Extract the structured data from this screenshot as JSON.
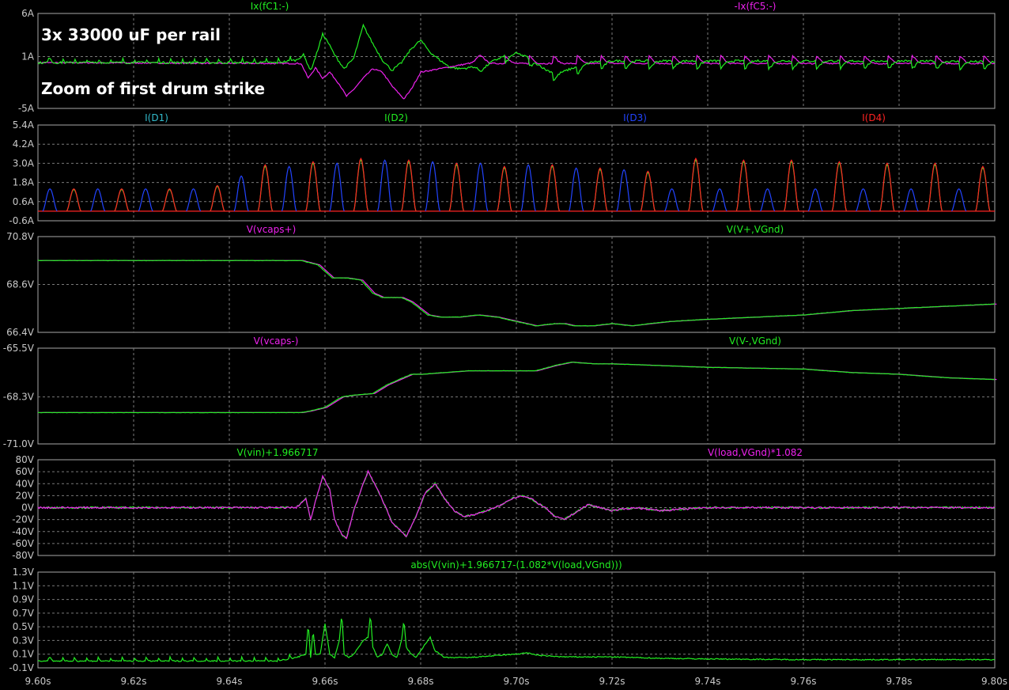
{
  "annotations": {
    "line1": "3x 33000 uF per rail",
    "line2": "Zoom of first drum strike"
  },
  "colors": {
    "background": "#000000",
    "frame": "#a8a8a8",
    "grid": "#7a7a7a",
    "axis_text": "#c8c8c8",
    "green": "#22ee22",
    "magenta": "#ee22ee",
    "blue": "#2244ff",
    "red": "#ff2222",
    "teal": "#33bbcc"
  },
  "chart_data": {
    "type": "line",
    "x_axis": {
      "label": "",
      "range": [
        9.6,
        9.8
      ],
      "ticks": [
        9.6,
        9.62,
        9.64,
        9.66,
        9.68,
        9.7,
        9.72,
        9.74,
        9.76,
        9.78,
        9.8
      ],
      "tick_labels": [
        "9.60s",
        "9.62s",
        "9.64s",
        "9.66s",
        "9.68s",
        "9.70s",
        "9.72s",
        "9.74s",
        "9.76s",
        "9.78s",
        "9.80s"
      ]
    },
    "panes": [
      {
        "id": "cap_currents",
        "ylim": [
          -5,
          6
        ],
        "ticks": [
          -5,
          1,
          6
        ],
        "tick_labels": [
          "-5A",
          "1A",
          "6A"
        ],
        "series": [
          {
            "name": "Ix(fC1:-)",
            "color": "#22ee22",
            "x": [
              9.6,
              9.65,
              9.654,
              9.6555,
              9.657,
              9.658,
              9.6595,
              9.6605,
              9.662,
              9.664,
              9.666,
              9.668,
              9.67,
              9.672,
              9.674,
              9.676,
              9.678,
              9.68,
              9.682,
              9.684,
              9.686,
              9.688,
              9.69,
              9.692,
              9.694,
              9.696,
              9.698,
              9.7,
              9.702,
              9.704,
              9.706,
              9.708,
              9.71,
              9.712,
              9.716,
              9.72,
              9.74,
              9.76,
              9.78,
              9.8
            ],
            "y": [
              0.3,
              0.3,
              0.6,
              1.2,
              -0.6,
              0.9,
              3.6,
              2.8,
              1.2,
              -0.4,
              0.8,
              4.6,
              2.5,
              0.6,
              -0.6,
              0.3,
              1.9,
              2.9,
              1.5,
              0.6,
              -0.2,
              -0.4,
              -0.3,
              0.3,
              0.2,
              0.7,
              1.2,
              1.4,
              1.0,
              0.4,
              -0.5,
              -0.9,
              -0.7,
              -0.3,
              0.4,
              0.5,
              0.5,
              0.5,
              0.5,
              0.4
            ]
          },
          {
            "name": "-Ix(fC5:-)",
            "color": "#ee22ee",
            "x": [
              9.6,
              9.655,
              9.6565,
              9.658,
              9.6595,
              9.661,
              9.663,
              9.6645,
              9.666,
              9.668,
              9.67,
              9.672,
              9.674,
              9.6765,
              9.678,
              9.68,
              9.69,
              9.7,
              9.72,
              9.74,
              9.76,
              9.78,
              9.8
            ],
            "y": [
              0.3,
              0.2,
              -1.5,
              -0.3,
              -1.5,
              -0.8,
              -2.2,
              -3.6,
              -2.8,
              -1.5,
              -0.4,
              -0.8,
              -2.4,
              -3.9,
              -2.8,
              -0.8,
              0.2,
              0.2,
              0.2,
              0.2,
              0.2,
              0.2,
              0.2
            ]
          }
        ]
      },
      {
        "id": "diode_currents",
        "ylim": [
          -0.6,
          5.4
        ],
        "ticks": [
          -0.6,
          0.6,
          1.8,
          3.0,
          4.2,
          5.4
        ],
        "tick_labels": [
          "-0.6A",
          "0.6A",
          "1.8A",
          "3.0A",
          "4.2A",
          "5.4A"
        ],
        "series": [
          {
            "name": "I(D1)",
            "color": "#33bbcc"
          },
          {
            "name": "I(D2)",
            "color": "#22ee22"
          },
          {
            "name": "I(D3)",
            "color": "#2244ff"
          },
          {
            "name": "I(D4)",
            "color": "#ff2222"
          }
        ],
        "pulses": {
          "times": [
            9.6025,
            9.6075,
            9.6125,
            9.6175,
            9.6225,
            9.6275,
            9.6325,
            9.6375,
            9.6425,
            9.6475,
            9.6525,
            9.6575,
            9.6625,
            9.6675,
            9.6725,
            9.6775,
            9.6825,
            9.6875,
            9.6925,
            9.6975,
            9.7025,
            9.7075,
            9.7125,
            9.7175,
            9.7225,
            9.7275,
            9.7325,
            9.7375,
            9.7425,
            9.7475,
            9.7525,
            9.7575,
            9.7625,
            9.7675,
            9.7725,
            9.7775,
            9.7825,
            9.7875,
            9.7925,
            9.7975
          ],
          "peaks": [
            0,
            1.4,
            0,
            1.4,
            0,
            1.4,
            0,
            1.4,
            0,
            1.4,
            0,
            1.4,
            0,
            1.4,
            0,
            1.6,
            0,
            2.2,
            0,
            2.9,
            0,
            2.8,
            0,
            3.1,
            0,
            3.0,
            0,
            3.3,
            0,
            3.2,
            0,
            3.2,
            0,
            3.1,
            0,
            3.0,
            0,
            3.0,
            0,
            2.8,
            0,
            2.9,
            0,
            2.9,
            0,
            2.7,
            0,
            2.7,
            0,
            2.6,
            0,
            2.5
          ],
          "half_width": 0.0015
        }
      },
      {
        "id": "pos_rail",
        "ylim": [
          66.4,
          70.8
        ],
        "ticks": [
          66.4,
          68.6,
          70.8
        ],
        "tick_labels": [
          "66.4V",
          "68.6V",
          "70.8V"
        ],
        "series": [
          {
            "name": "V(vcaps+)",
            "color": "#ee22ee"
          },
          {
            "name": "V(V+,VGnd)",
            "color": "#22ee22",
            "x": [
              9.6,
              9.655,
              9.6585,
              9.6615,
              9.6645,
              9.6675,
              9.67,
              9.672,
              9.676,
              9.678,
              9.6815,
              9.684,
              9.688,
              9.692,
              9.696,
              9.7,
              9.704,
              9.708,
              9.71,
              9.712,
              9.716,
              9.72,
              9.724,
              9.728,
              9.732,
              9.74,
              9.75,
              9.76,
              9.77,
              9.78,
              9.79,
              9.8
            ],
            "y": [
              69.7,
              69.7,
              69.5,
              68.9,
              68.9,
              68.8,
              68.2,
              68.0,
              68.0,
              67.8,
              67.2,
              67.1,
              67.1,
              67.2,
              67.1,
              66.9,
              66.7,
              66.8,
              66.8,
              66.7,
              66.7,
              66.8,
              66.7,
              66.8,
              66.9,
              67.0,
              67.1,
              67.2,
              67.4,
              67.5,
              67.6,
              67.7
            ]
          }
        ]
      },
      {
        "id": "neg_rail",
        "ylim": [
          -71.0,
          -65.5
        ],
        "ticks": [
          -71.0,
          -68.3,
          -65.5
        ],
        "tick_labels": [
          "-71.0V",
          "-68.3V",
          "-65.5V"
        ],
        "series": [
          {
            "name": "V(vcaps-)",
            "color": "#ee22ee"
          },
          {
            "name": "V(V-,VGnd)",
            "color": "#22ee22",
            "x": [
              9.6,
              9.655,
              9.657,
              9.66,
              9.6635,
              9.666,
              9.67,
              9.673,
              9.678,
              9.68,
              9.69,
              9.7,
              9.704,
              9.708,
              9.7115,
              9.716,
              9.72,
              9.74,
              9.76,
              9.77,
              9.78,
              9.79,
              9.8
            ],
            "y": [
              -69.2,
              -69.2,
              -69.1,
              -68.9,
              -68.3,
              -68.2,
              -68.1,
              -67.6,
              -67.0,
              -67.0,
              -66.8,
              -66.8,
              -66.8,
              -66.5,
              -66.3,
              -66.4,
              -66.4,
              -66.6,
              -66.7,
              -66.9,
              -67.0,
              -67.2,
              -67.3
            ]
          }
        ]
      },
      {
        "id": "vin_vs_load",
        "ylim": [
          -80,
          80
        ],
        "ticks": [
          -80,
          -60,
          -40,
          -20,
          0,
          20,
          40,
          60,
          80
        ],
        "tick_labels": [
          "-80V",
          "-60V",
          "-40V",
          "-20V",
          "0V",
          "20V",
          "40V",
          "60V",
          "80V"
        ],
        "series": [
          {
            "name": "V(vin)+1.966717",
            "color": "#22ee22"
          },
          {
            "name": "V(load,VGnd)*1.082",
            "color": "#ee22ee",
            "x": [
              9.6,
              9.654,
              9.656,
              9.657,
              9.658,
              9.6595,
              9.661,
              9.662,
              9.6635,
              9.6645,
              9.666,
              9.668,
              9.669,
              9.671,
              9.673,
              9.674,
              9.676,
              9.677,
              9.679,
              9.681,
              9.683,
              9.685,
              9.687,
              9.689,
              9.691,
              9.694,
              9.697,
              9.699,
              9.701,
              9.703,
              9.706,
              9.708,
              9.71,
              9.712,
              9.715,
              9.72,
              9.725,
              9.73,
              9.74,
              9.76,
              9.78,
              9.8
            ],
            "y": [
              0,
              0,
              15,
              -20,
              10,
              52,
              30,
              -20,
              -45,
              -52,
              -5,
              40,
              60,
              30,
              -5,
              -25,
              -40,
              -48,
              -15,
              25,
              40,
              15,
              -5,
              -15,
              -12,
              -5,
              5,
              15,
              20,
              15,
              0,
              -15,
              -20,
              -10,
              5,
              -5,
              0,
              -5,
              0,
              0,
              0,
              0
            ]
          }
        ]
      },
      {
        "id": "error",
        "ylim": [
          -0.1,
          1.3
        ],
        "ticks": [
          -0.1,
          0.1,
          0.3,
          0.5,
          0.7,
          0.9,
          1.1,
          1.3
        ],
        "tick_labels": [
          "-0.1V",
          "0.1V",
          "0.3V",
          "0.5V",
          "0.7V",
          "0.9V",
          "1.1V",
          "1.3V"
        ],
        "series": [
          {
            "name": "abs(V(vin)+1.966717-(1.082*V(load,VGnd)))",
            "color": "#22ee22",
            "x": [
              9.6,
              9.65,
              9.654,
              9.656,
              9.6565,
              9.657,
              9.6575,
              9.658,
              9.659,
              9.66,
              9.661,
              9.662,
              9.663,
              9.6635,
              9.664,
              9.665,
              9.666,
              9.667,
              9.668,
              9.669,
              9.6695,
              9.67,
              9.671,
              9.672,
              9.673,
              9.674,
              9.675,
              9.676,
              9.6765,
              9.677,
              9.678,
              9.679,
              9.68,
              9.681,
              9.682,
              9.683,
              9.685,
              9.69,
              9.7,
              9.702,
              9.705,
              9.71,
              9.72,
              9.73,
              9.74,
              9.76,
              9.78,
              9.8
            ],
            "y": [
              0.0,
              0.0,
              0.05,
              0.1,
              0.55,
              0.05,
              0.45,
              0.1,
              0.1,
              0.55,
              0.1,
              0.05,
              0.3,
              0.7,
              0.1,
              0.05,
              0.1,
              0.2,
              0.3,
              0.35,
              0.68,
              0.2,
              0.05,
              0.1,
              0.25,
              0.1,
              0.05,
              0.3,
              0.6,
              0.2,
              0.1,
              0.05,
              0.15,
              0.25,
              0.35,
              0.15,
              0.05,
              0.05,
              0.1,
              0.12,
              0.08,
              0.06,
              0.06,
              0.04,
              0.03,
              0.02,
              0.02,
              0.02
            ]
          }
        ]
      }
    ]
  }
}
